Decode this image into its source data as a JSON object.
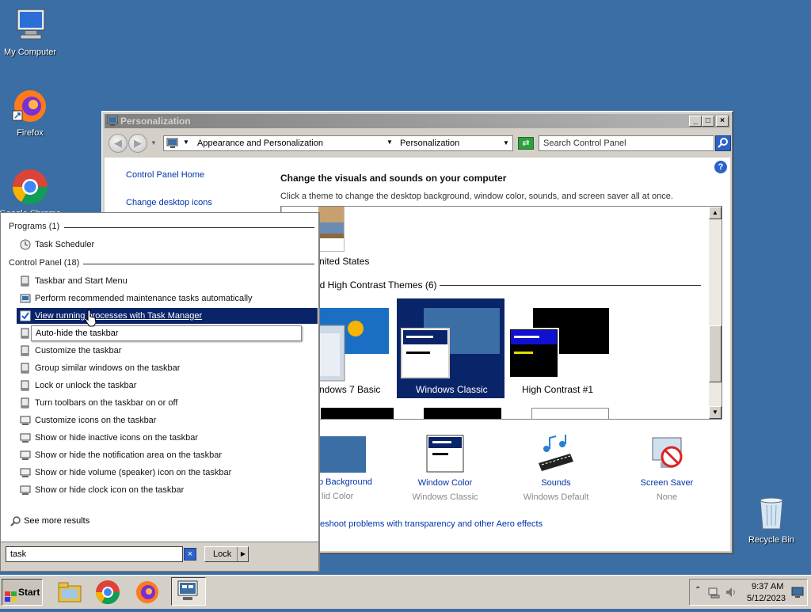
{
  "desktop": {
    "icons": [
      {
        "label": "My Computer",
        "icon": "computer-icon"
      },
      {
        "label": "Firefox",
        "icon": "firefox-icon"
      },
      {
        "label": "Google Chrome",
        "icon": "chrome-icon"
      },
      {
        "label": "Recycle Bin",
        "icon": "recycle-bin-icon"
      }
    ]
  },
  "window": {
    "title": "Personalization",
    "breadcrumb": [
      "Appearance and Personalization",
      "Personalization"
    ],
    "search_placeholder": "Search Control Panel",
    "left_links": [
      "Control Panel Home",
      "Change desktop icons"
    ],
    "heading": "Change the visuals and sounds on your computer",
    "subheading": "Click a theme to change the desktop background, window color, sounds, and screen saver all at once.",
    "my_theme_label": "nited States",
    "basic_group_label": "nd High Contrast Themes (6)",
    "themes": [
      {
        "label": "ndows 7 Basic"
      },
      {
        "label": "Windows Classic",
        "selected": true
      },
      {
        "label": "High Contrast #1"
      }
    ],
    "bottom_items": [
      {
        "title": "p Background",
        "sub": "lid Color"
      },
      {
        "title": "Window Color",
        "sub": "Windows Classic"
      },
      {
        "title": "Sounds",
        "sub": "Windows Default"
      },
      {
        "title": "Screen Saver",
        "sub": "None"
      }
    ],
    "troubleshoot_link": "eshoot problems with transparency and other Aero effects"
  },
  "start_menu": {
    "programs_header": "Programs (1)",
    "programs": [
      "Task Scheduler"
    ],
    "control_panel_header": "Control Panel (18)",
    "control_panel_items": [
      "Taskbar and Start Menu",
      "Perform recommended maintenance tasks automatically",
      "View running processes with Task Manager",
      "Auto-hide the taskbar",
      "Customize the taskbar",
      "Group similar windows on the taskbar",
      "Lock or unlock the taskbar",
      "Turn toolbars on the taskbar on or off",
      "Customize icons on the taskbar",
      "Show or hide inactive icons on the taskbar",
      "Show or hide the notification area on the taskbar",
      "Show or hide volume (speaker) icon on the taskbar",
      "Show or hide clock icon on the taskbar"
    ],
    "selected_item": "View running processes with Task Manager",
    "tooltip": "Auto-hide the taskbar",
    "see_more": "See more results",
    "search_value": "task",
    "lock_label": "Lock"
  },
  "taskbar": {
    "start_label": "Start",
    "time": "9:37 AM",
    "date": "5/12/2023"
  }
}
